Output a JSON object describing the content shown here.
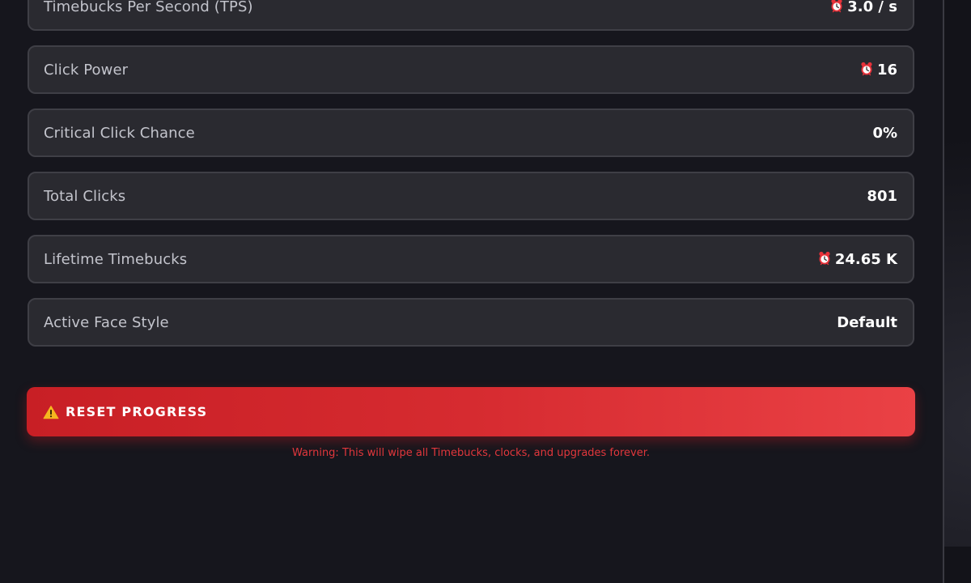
{
  "stats": [
    {
      "label": "Timebucks Per Second (TPS)",
      "value": "3.0 / s",
      "icon": "clock-icon"
    },
    {
      "label": "Click Power",
      "value": "16",
      "icon": "clock-icon"
    },
    {
      "label": "Critical Click Chance",
      "value": "0%",
      "icon": null
    },
    {
      "label": "Total Clicks",
      "value": "801",
      "icon": null
    },
    {
      "label": "Lifetime Timebucks",
      "value": "24.65 K",
      "icon": "clock-icon"
    },
    {
      "label": "Active Face Style",
      "value": "Default",
      "icon": null
    }
  ],
  "reset": {
    "icon": "warning-icon",
    "label": "RESET PROGRESS",
    "warning": "Warning: This will wipe all Timebucks, clocks, and upgrades forever."
  },
  "colors": {
    "background": "#131319",
    "row_background": "#2a2a30",
    "row_border": "#3f3f46",
    "danger": "#e2373c",
    "danger_button_start": "#c81f25",
    "danger_button_end": "#ea4145"
  }
}
